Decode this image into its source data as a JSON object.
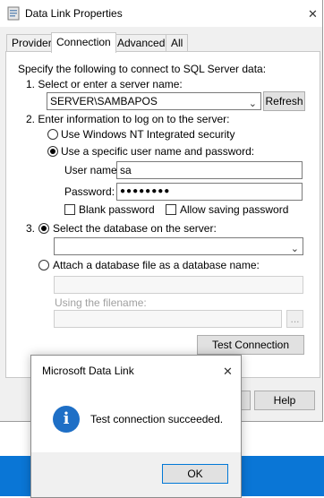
{
  "window": {
    "title": "Data Link Properties",
    "close_glyph": "✕"
  },
  "tabs": [
    {
      "label": "Provider",
      "active": false
    },
    {
      "label": "Connection",
      "active": true
    },
    {
      "label": "Advanced",
      "active": false
    },
    {
      "label": "All",
      "active": false
    }
  ],
  "connection": {
    "instruction": "Specify the following to connect to SQL Server data:",
    "step1_label": "1. Select or enter a server name:",
    "server_value": "SERVER\\SAMBAPOS",
    "refresh_label": "Refresh",
    "step2_label": "2. Enter information to log on to the server:",
    "radio_windows_label": "Use Windows NT Integrated security",
    "radio_specific_label": "Use a specific user name and password:",
    "username_label": "User name:",
    "username_value": "sa",
    "password_label": "Password:",
    "password_value": "●●●●●●●●",
    "blank_password_label": "Blank password",
    "allow_saving_label": "Allow saving password",
    "step3_number": "3.",
    "radio_select_db_label": "Select the database on the server:",
    "database_value": "",
    "radio_attach_label": "Attach a database file as a database name:",
    "attach_value": "",
    "using_filename_label": "Using the filename:",
    "filename_value": "",
    "browse_label": "...",
    "test_connection_label": "Test Connection"
  },
  "footer": {
    "help_label": "Help"
  },
  "popup": {
    "title": "Microsoft Data Link",
    "close_glyph": "✕",
    "message": "Test connection succeeded.",
    "icon_glyph": "i",
    "ok_label": "OK"
  },
  "colors": {
    "info_icon": "#1e6fc6",
    "taskbar": "#0a76d6",
    "focus_border": "#0078d7"
  }
}
